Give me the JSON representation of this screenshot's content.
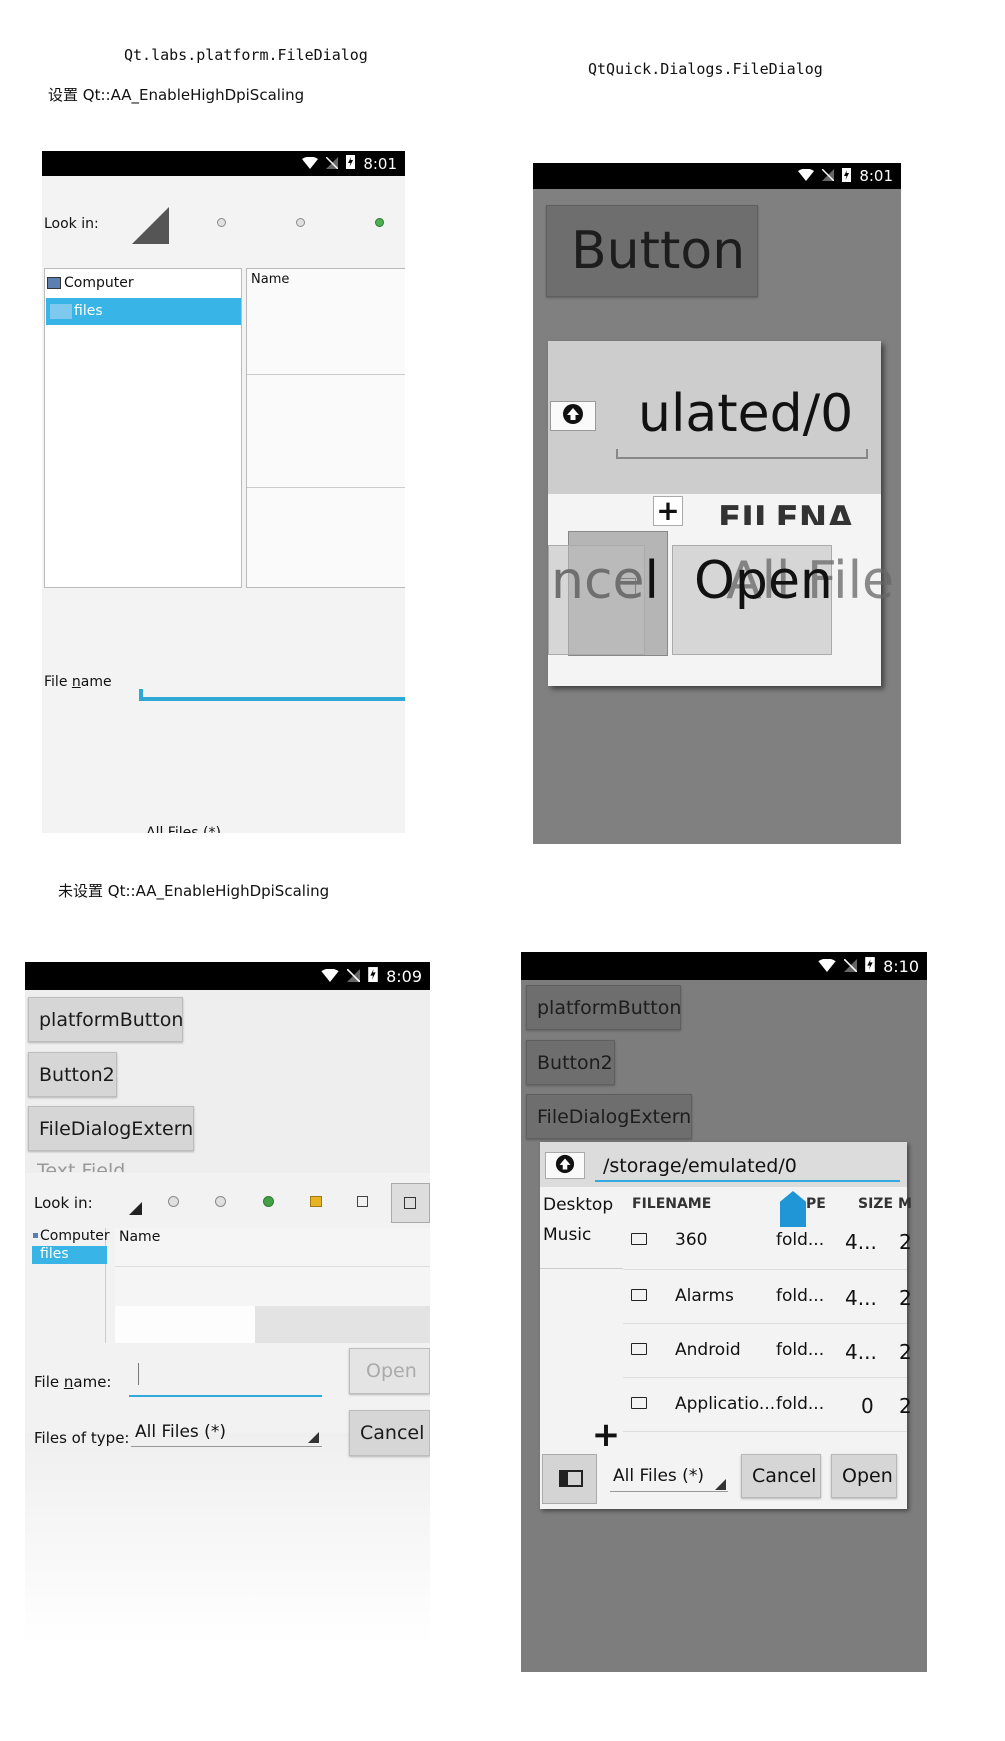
{
  "captions": {
    "left_title": "Qt.labs.platform.FileDialog",
    "right_title": "QtQuick.Dialogs.FileDialog",
    "hidpi_on": "设置 Qt::AA_EnableHighDpiScaling",
    "hidpi_off": "未设置 Qt::AA_EnableHighDpiScaling"
  },
  "phone_a": {
    "time": "8:01",
    "look_in": "Look in:",
    "sidebar_items": [
      "Computer",
      "files"
    ],
    "column_name": "Name",
    "file_name_label": "File name",
    "file_name_mnemonic": "n",
    "cut_text": "All Files (*)"
  },
  "phone_b": {
    "time": "8:01",
    "button": "Button",
    "path_fragment": "ulated/0",
    "filename_header": "FILENA",
    "cancel_fragment": "ncel",
    "open_label": "Open",
    "all_files_fragment": "All File"
  },
  "phone_c": {
    "time": "8:09",
    "buttons": [
      "platformButton",
      "Button2",
      "FileDialogExtern"
    ],
    "text_field_placeholder": "Text Field",
    "look_in": "Look in:",
    "sidebar_items": [
      "Computer",
      "files"
    ],
    "column_name": "Name",
    "file_name_label": "File name:",
    "file_name_mnemonic": "n",
    "open_label": "Open",
    "files_of_type_label": "Files of type:",
    "files_of_type_value": "All Files (*)",
    "cancel_label": "Cancel"
  },
  "phone_d": {
    "time": "8:10",
    "buttons": [
      "platformButton",
      "Button2",
      "FileDialogExtern"
    ],
    "path": "/storage/emulated/0",
    "bookmarks": [
      "Desktop",
      "Music"
    ],
    "columns": [
      "FILENAME",
      "PE",
      "SIZE",
      "M"
    ],
    "rows": [
      {
        "name": "360",
        "type": "fold...",
        "size": "4...",
        "mod": "2"
      },
      {
        "name": "Alarms",
        "type": "fold...",
        "size": "4...",
        "mod": "2"
      },
      {
        "name": "Android",
        "type": "fold...",
        "size": "4...",
        "mod": "2"
      },
      {
        "name": "Applicatio...",
        "type": "fold...",
        "size": "0",
        "mod": "2"
      }
    ],
    "filter": "All Files (*)",
    "cancel_label": "Cancel",
    "open_label": "Open"
  }
}
